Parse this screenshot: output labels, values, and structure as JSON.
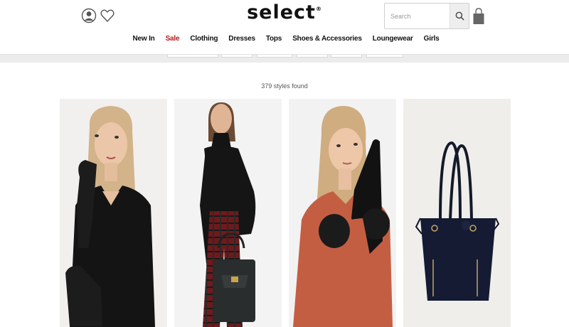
{
  "brand": {
    "logo_text": "select",
    "logo_mark": "®"
  },
  "header": {
    "account_icon": "account-icon",
    "wishlist_icon": "heart-icon",
    "search": {
      "placeholder": "Search",
      "icon": "search-icon"
    },
    "bag_icon": "shopping-bag-icon"
  },
  "nav": {
    "items": [
      {
        "label": "New In"
      },
      {
        "label": "Sale",
        "highlight": "#b3191c"
      },
      {
        "label": "Clothing"
      },
      {
        "label": "Dresses"
      },
      {
        "label": "Tops"
      },
      {
        "label": "Shoes & Accessories"
      },
      {
        "label": "Loungewear"
      },
      {
        "label": "Girls"
      }
    ]
  },
  "results": {
    "count_text": "379 styles found"
  },
  "products": [
    {
      "description": "model in black cut-out jumper with leather gloves"
    },
    {
      "description": "model in black top and tartan trousers holding handbag"
    },
    {
      "description": "model in rust knit jumper with faux fur gloves"
    },
    {
      "description": "navy tote bag"
    }
  ],
  "colors": {
    "sale": "#b3191c",
    "text": "#111111"
  }
}
